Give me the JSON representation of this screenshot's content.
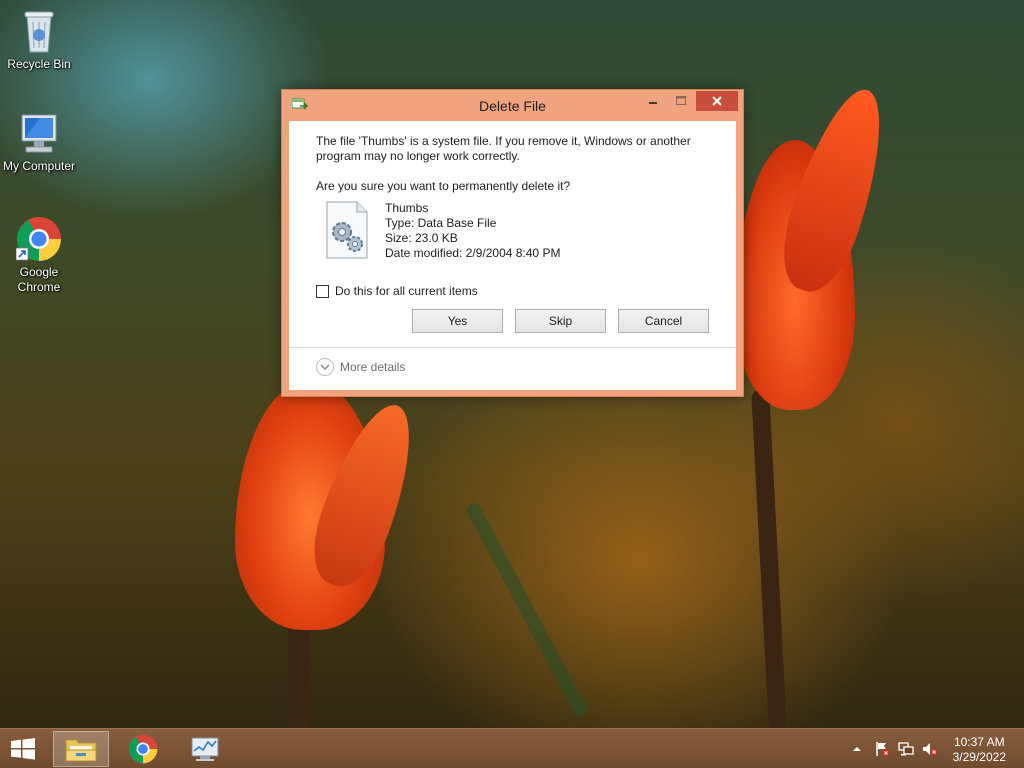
{
  "desktop": {
    "icons": [
      {
        "label": "Recycle Bin",
        "icon": "recycle-bin-icon"
      },
      {
        "label": "My Computer",
        "icon": "computer-icon"
      },
      {
        "label": "Google Chrome",
        "icon": "chrome-icon"
      }
    ]
  },
  "dialog": {
    "title": "Delete File",
    "message": "The file 'Thumbs' is a system file. If you remove it, Windows or another program may no longer work correctly.",
    "question": "Are you sure you want to permanently delete it?",
    "file": {
      "name": "Thumbs",
      "type": "Type: Data Base File",
      "size": "Size: 23.0 KB",
      "date_modified": "Date modified: 2/9/2004 8:40 PM"
    },
    "checkbox_label": "Do this for all current items",
    "checkbox_checked": false,
    "buttons": {
      "yes": "Yes",
      "skip": "Skip",
      "cancel": "Cancel"
    },
    "more_details": "More details",
    "accent_color": "#f1a27e",
    "close_color": "#c74e3a"
  },
  "taskbar": {
    "items": [
      {
        "name": "file-explorer",
        "active": true
      },
      {
        "name": "google-chrome",
        "active": false
      },
      {
        "name": "performance-monitor",
        "active": false
      }
    ],
    "tray": [
      "show-hidden-icons",
      "action-center-flag",
      "network",
      "volume-muted"
    ],
    "time": "10:37 AM",
    "date": "3/29/2022"
  }
}
